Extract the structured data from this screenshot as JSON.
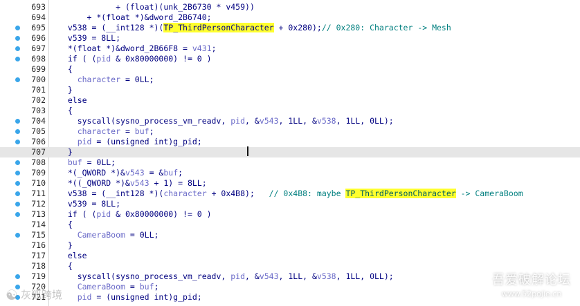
{
  "editor": {
    "lines": [
      {
        "num": "693",
        "bp": false,
        "current": false,
        "tokens": [
          {
            "t": "            + (float)(unk_2B6730 * v459))",
            "c": "p"
          }
        ]
      },
      {
        "num": "694",
        "bp": false,
        "current": false,
        "tokens": [
          {
            "t": "      + *(float *)&dword_2B6740;",
            "c": "p"
          }
        ]
      },
      {
        "num": "695",
        "bp": true,
        "current": false,
        "tokens": [
          {
            "t": "  ",
            "c": "p"
          },
          {
            "t": "v538",
            "c": "p"
          },
          {
            "t": " = (__int128 *)(",
            "c": "p"
          },
          {
            "t": "TP_ThirdPersonCharacter",
            "c": "hl"
          },
          {
            "t": " + 0x280);",
            "c": "p"
          },
          {
            "t": "// 0x280: Character -> Mesh",
            "c": "c"
          }
        ]
      },
      {
        "num": "696",
        "bp": true,
        "current": false,
        "tokens": [
          {
            "t": "  v539 = 8LL;",
            "c": "p"
          }
        ]
      },
      {
        "num": "697",
        "bp": true,
        "current": false,
        "tokens": [
          {
            "t": "  *(float *)&dword_2B66F8 = ",
            "c": "p"
          },
          {
            "t": "v431",
            "c": "v"
          },
          {
            "t": ";",
            "c": "p"
          }
        ]
      },
      {
        "num": "698",
        "bp": true,
        "current": false,
        "tokens": [
          {
            "t": "  if ( (",
            "c": "p"
          },
          {
            "t": "pid",
            "c": "v"
          },
          {
            "t": " & 0x80000000) != 0 )",
            "c": "p"
          }
        ]
      },
      {
        "num": "699",
        "bp": false,
        "current": false,
        "tokens": [
          {
            "t": "  {",
            "c": "p"
          }
        ]
      },
      {
        "num": "700",
        "bp": true,
        "current": false,
        "tokens": [
          {
            "t": "    ",
            "c": "p"
          },
          {
            "t": "character",
            "c": "v"
          },
          {
            "t": " = 0LL;",
            "c": "p"
          }
        ]
      },
      {
        "num": "701",
        "bp": false,
        "current": false,
        "tokens": [
          {
            "t": "  }",
            "c": "p"
          }
        ]
      },
      {
        "num": "702",
        "bp": false,
        "current": false,
        "tokens": [
          {
            "t": "  else",
            "c": "p"
          }
        ]
      },
      {
        "num": "703",
        "bp": false,
        "current": false,
        "tokens": [
          {
            "t": "  {",
            "c": "p"
          }
        ]
      },
      {
        "num": "704",
        "bp": true,
        "current": false,
        "tokens": [
          {
            "t": "    syscall(sysno_process_vm_readv, ",
            "c": "p"
          },
          {
            "t": "pid",
            "c": "v"
          },
          {
            "t": ", &",
            "c": "p"
          },
          {
            "t": "v543",
            "c": "v"
          },
          {
            "t": ", 1LL, &",
            "c": "p"
          },
          {
            "t": "v538",
            "c": "v"
          },
          {
            "t": ", 1LL, 0LL);",
            "c": "p"
          }
        ]
      },
      {
        "num": "705",
        "bp": true,
        "current": false,
        "tokens": [
          {
            "t": "    ",
            "c": "p"
          },
          {
            "t": "character",
            "c": "v"
          },
          {
            "t": " = ",
            "c": "p"
          },
          {
            "t": "buf",
            "c": "v"
          },
          {
            "t": ";",
            "c": "p"
          }
        ]
      },
      {
        "num": "706",
        "bp": true,
        "current": false,
        "tokens": [
          {
            "t": "    ",
            "c": "p"
          },
          {
            "t": "pid",
            "c": "v"
          },
          {
            "t": " = (unsigned int)g_pid;",
            "c": "p"
          }
        ]
      },
      {
        "num": "707",
        "bp": false,
        "current": true,
        "tokens": [
          {
            "t": "  }",
            "c": "p"
          }
        ]
      },
      {
        "num": "708",
        "bp": true,
        "current": false,
        "tokens": [
          {
            "t": "  ",
            "c": "p"
          },
          {
            "t": "buf",
            "c": "v"
          },
          {
            "t": " = 0LL;",
            "c": "p"
          }
        ]
      },
      {
        "num": "709",
        "bp": true,
        "current": false,
        "tokens": [
          {
            "t": "  *(_QWORD *)&",
            "c": "p"
          },
          {
            "t": "v543",
            "c": "v"
          },
          {
            "t": " = &",
            "c": "p"
          },
          {
            "t": "buf",
            "c": "v"
          },
          {
            "t": ";",
            "c": "p"
          }
        ]
      },
      {
        "num": "710",
        "bp": true,
        "current": false,
        "tokens": [
          {
            "t": "  *((_QWORD *)&",
            "c": "p"
          },
          {
            "t": "v543",
            "c": "v"
          },
          {
            "t": " + 1) = 8LL;",
            "c": "p"
          }
        ]
      },
      {
        "num": "711",
        "bp": true,
        "current": false,
        "tokens": [
          {
            "t": "  v538 = (__int128 *)(",
            "c": "p"
          },
          {
            "t": "character",
            "c": "v"
          },
          {
            "t": " + 0x4B8);   ",
            "c": "p"
          },
          {
            "t": "// 0x4B8: maybe ",
            "c": "c"
          },
          {
            "t": "TP_ThirdPersonCharacter",
            "c": "hlc"
          },
          {
            "t": " -> CameraBoom",
            "c": "c"
          }
        ]
      },
      {
        "num": "712",
        "bp": true,
        "current": false,
        "tokens": [
          {
            "t": "  v539 = 8LL;",
            "c": "p"
          }
        ]
      },
      {
        "num": "713",
        "bp": true,
        "current": false,
        "tokens": [
          {
            "t": "  if ( (",
            "c": "p"
          },
          {
            "t": "pid",
            "c": "v"
          },
          {
            "t": " & 0x80000000) != 0 )",
            "c": "p"
          }
        ]
      },
      {
        "num": "714",
        "bp": false,
        "current": false,
        "tokens": [
          {
            "t": "  {",
            "c": "p"
          }
        ]
      },
      {
        "num": "715",
        "bp": true,
        "current": false,
        "tokens": [
          {
            "t": "    ",
            "c": "p"
          },
          {
            "t": "CameraBoom",
            "c": "v"
          },
          {
            "t": " = 0LL;",
            "c": "p"
          }
        ]
      },
      {
        "num": "716",
        "bp": false,
        "current": false,
        "tokens": [
          {
            "t": "  }",
            "c": "p"
          }
        ]
      },
      {
        "num": "717",
        "bp": false,
        "current": false,
        "tokens": [
          {
            "t": "  else",
            "c": "p"
          }
        ]
      },
      {
        "num": "718",
        "bp": false,
        "current": false,
        "tokens": [
          {
            "t": "  {",
            "c": "p"
          }
        ]
      },
      {
        "num": "719",
        "bp": true,
        "current": false,
        "tokens": [
          {
            "t": "    syscall(sysno_process_vm_readv, ",
            "c": "p"
          },
          {
            "t": "pid",
            "c": "v"
          },
          {
            "t": ", &",
            "c": "p"
          },
          {
            "t": "v543",
            "c": "v"
          },
          {
            "t": ", 1LL, &",
            "c": "p"
          },
          {
            "t": "v538",
            "c": "v"
          },
          {
            "t": ", 1LL, 0LL);",
            "c": "p"
          }
        ]
      },
      {
        "num": "720",
        "bp": true,
        "current": false,
        "tokens": [
          {
            "t": "    ",
            "c": "p"
          },
          {
            "t": "CameraBoom",
            "c": "v"
          },
          {
            "t": " = ",
            "c": "p"
          },
          {
            "t": "buf",
            "c": "v"
          },
          {
            "t": ";",
            "c": "p"
          }
        ]
      },
      {
        "num": "721",
        "bp": true,
        "current": false,
        "tokens": [
          {
            "t": "    ",
            "c": "p"
          },
          {
            "t": "pid",
            "c": "v"
          },
          {
            "t": " = (unsigned int)g_pid;",
            "c": "p"
          }
        ]
      }
    ]
  },
  "watermarks": {
    "left_text": "灰狐跨境",
    "right_title": "吾爱破解论坛",
    "right_url": "www.52pojie.cn"
  },
  "colors": {
    "plain": "#000080",
    "variable": "#6a6ac8",
    "comment": "#007f7f",
    "highlight": "#ffff2e",
    "breakpoint_dot": "#3aa6ea",
    "current_line": "#e6e6e6"
  }
}
